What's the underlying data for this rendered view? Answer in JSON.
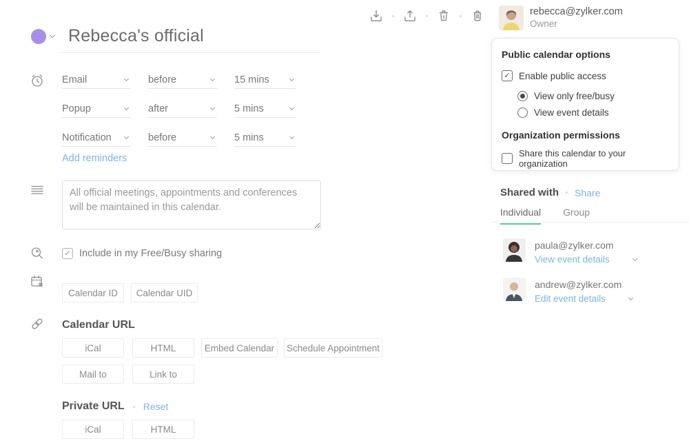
{
  "colors": {
    "accent_purple": "#a78fe8",
    "link_blue": "#7db4e2",
    "tab_teal": "#57c6a8"
  },
  "header": {
    "calendar_title": "Rebecca's official"
  },
  "toolbar": {
    "icons": [
      "import-icon",
      "export-icon",
      "empty-trash-icon",
      "delete-calendar-icon"
    ]
  },
  "owner": {
    "email": "rebecca@zylker.com",
    "role": "Owner"
  },
  "reminders": {
    "rows": [
      {
        "method": "Email",
        "when": "before",
        "duration": "15 mins"
      },
      {
        "method": "Popup",
        "when": "after",
        "duration": "5 mins"
      },
      {
        "method": "Notification",
        "when": "before",
        "duration": "5 mins"
      }
    ],
    "add_label": "Add reminders"
  },
  "description": {
    "value": "All official meetings, appointments and conferences will be maintained in this calendar."
  },
  "freebusy": {
    "label": "Include in my Free/Busy sharing",
    "checked": true
  },
  "ids": {
    "calendar_id_label": "Calendar ID",
    "calendar_uid_label": "Calendar UID"
  },
  "calendar_url": {
    "title": "Calendar URL",
    "buttons_row1": [
      "iCal",
      "HTML",
      "Embed Calendar",
      "Schedule Appointment"
    ],
    "buttons_row2": [
      "Mail to",
      "Link to"
    ]
  },
  "private_url": {
    "title": "Private URL",
    "reset_label": "Reset",
    "buttons": [
      "iCal",
      "HTML"
    ]
  },
  "public_options": {
    "title": "Public calendar options",
    "enable_label": "Enable public access",
    "enable_checked": true,
    "radio_freebusy": "View only free/busy",
    "radio_details": "View event details",
    "selected_radio": "View only free/busy",
    "org_title": "Organization permissions",
    "org_share_label": "Share this calendar to your organization",
    "org_share_checked": false
  },
  "shared_with": {
    "title": "Shared with",
    "share_label": "Share",
    "tabs": [
      "Individual",
      "Group"
    ],
    "active_tab": "Individual",
    "people": [
      {
        "email": "paula@zylker.com",
        "permission": "View event details"
      },
      {
        "email": "andrew@zylker.com",
        "permission": "Edit event details"
      }
    ]
  }
}
